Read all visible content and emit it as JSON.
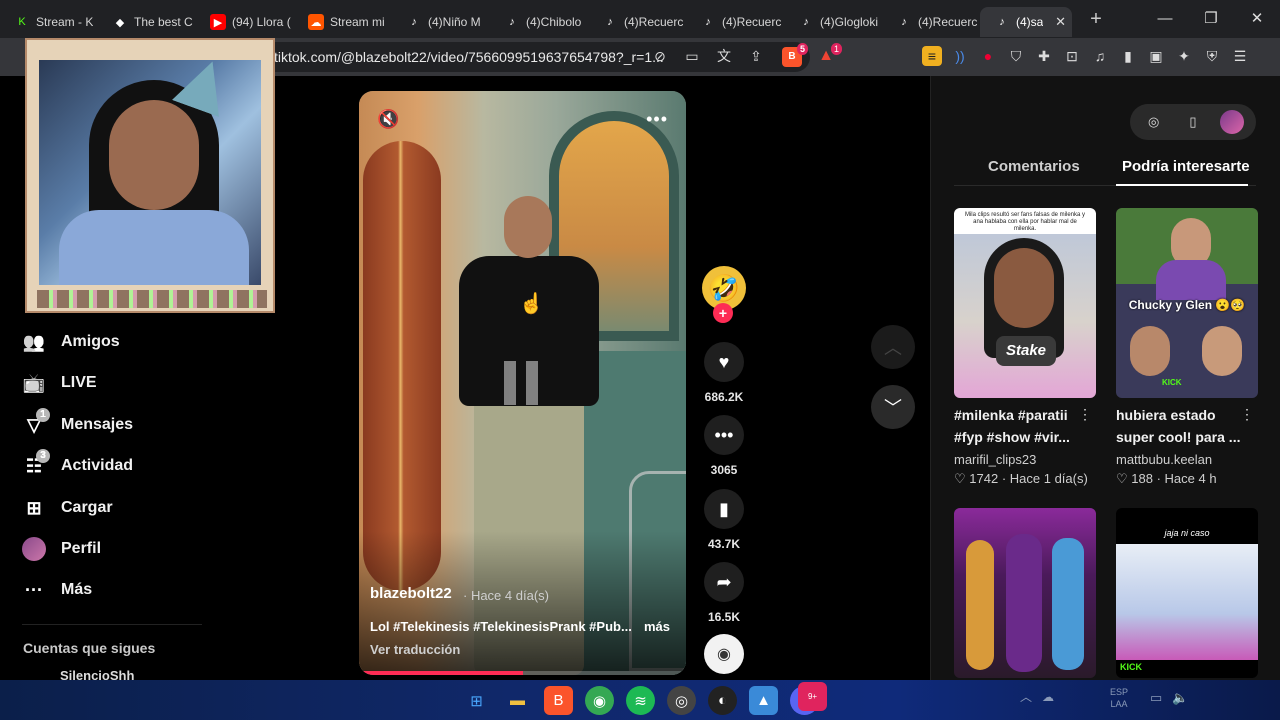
{
  "browser": {
    "tabs": [
      {
        "label": "Stream - K",
        "icon": "kick-icon",
        "color": "#53fc18"
      },
      {
        "label": "The best C",
        "icon": "diamond-icon",
        "color": "#ffffff"
      },
      {
        "label": "(94) Llora (",
        "icon": "youtube-icon",
        "color": "#ff0000"
      },
      {
        "label": "Stream mi",
        "icon": "soundcloud-icon",
        "color": "#ff5500"
      },
      {
        "label": "(4)Niño M",
        "icon": "tiktok-icon",
        "color": "#ffffff"
      },
      {
        "label": "(4)Chibolo",
        "icon": "tiktok-icon",
        "color": "#ffffff"
      },
      {
        "label": "(4)Recuerc",
        "icon": "tiktok-icon",
        "color": "#ffffff"
      },
      {
        "label": "(4)Recuerc",
        "icon": "tiktok-icon",
        "color": "#ffffff"
      },
      {
        "label": "(4)Glogloki",
        "icon": "tiktok-icon",
        "color": "#ffffff"
      },
      {
        "label": "(4)Recuerc",
        "icon": "tiktok-icon",
        "color": "#ffffff"
      },
      {
        "label": "(4)sa",
        "icon": "tiktok-icon",
        "color": "#ffffff",
        "active": true
      }
    ],
    "url": "tiktok.com/@blazebolt22/video/7566099519637654798?_r=1...",
    "brave_badge": "5",
    "alert_badge": "1"
  },
  "sidebar": {
    "items": [
      {
        "label": "Amigos",
        "icon": "friends-icon",
        "badge": ""
      },
      {
        "label": "LIVE",
        "icon": "live-tv-icon",
        "badge": ""
      },
      {
        "label": "Mensajes",
        "icon": "messages-icon",
        "badge": "1"
      },
      {
        "label": "Actividad",
        "icon": "activity-icon",
        "badge": "3"
      },
      {
        "label": "Cargar",
        "icon": "upload-icon",
        "badge": ""
      },
      {
        "label": "Perfil",
        "icon": "profile-avatar",
        "badge": ""
      },
      {
        "label": "Más",
        "icon": "more-icon",
        "badge": ""
      }
    ],
    "following_title": "Cuentas que sigues",
    "following": [
      "SilencioShh"
    ]
  },
  "video": {
    "author": "blazebolt22",
    "time": "· Hace 4 día(s)",
    "caption": "Lol #Telekinesis #TelekinesisPrank #Pub...",
    "more": "más",
    "translate": "Ver traducción",
    "progress": 0.5
  },
  "actions": {
    "likes": "686.2K",
    "comments": "3065",
    "saves": "43.7K",
    "shares": "16.5K"
  },
  "right_panel": {
    "tabs": [
      "Comentarios",
      "Podría interesarte"
    ],
    "active_tab": "Podría interesarte",
    "cards": [
      {
        "title": "#milenka #paratii #fyp #show #vir...",
        "user": "marifil_clips23",
        "likes": "1742",
        "time": "Hace 1 día(s)",
        "overlay": "Mila clips resultó ser fans falsas de milenka y ana hablaba con ella por hablar mal de milenka.",
        "logo": "Stake"
      },
      {
        "title": "hubiera estado super cool! para ...",
        "user": "mattbubu.keelan",
        "likes": "188",
        "time": "Hace 4 h",
        "overlay": "Chucky y Glen 😮🥺",
        "logo": "KICK"
      },
      {
        "title": "",
        "user": "",
        "likes": "",
        "time": "",
        "overlay": "",
        "logo": ""
      },
      {
        "title": "",
        "user": "",
        "likes": "",
        "time": "",
        "overlay": "jaja ni caso",
        "logo": "KICK"
      }
    ]
  },
  "taskbar": {
    "apps": [
      "windows-start-icon",
      "file-explorer-icon",
      "brave-browser-icon",
      "chrome-icon",
      "spotify-icon",
      "obs-icon",
      "camera-app-icon",
      "photos-icon",
      "discord-icon"
    ],
    "discord_badge": "9+",
    "lang_top": "ESP",
    "lang_bottom": "LAA"
  }
}
